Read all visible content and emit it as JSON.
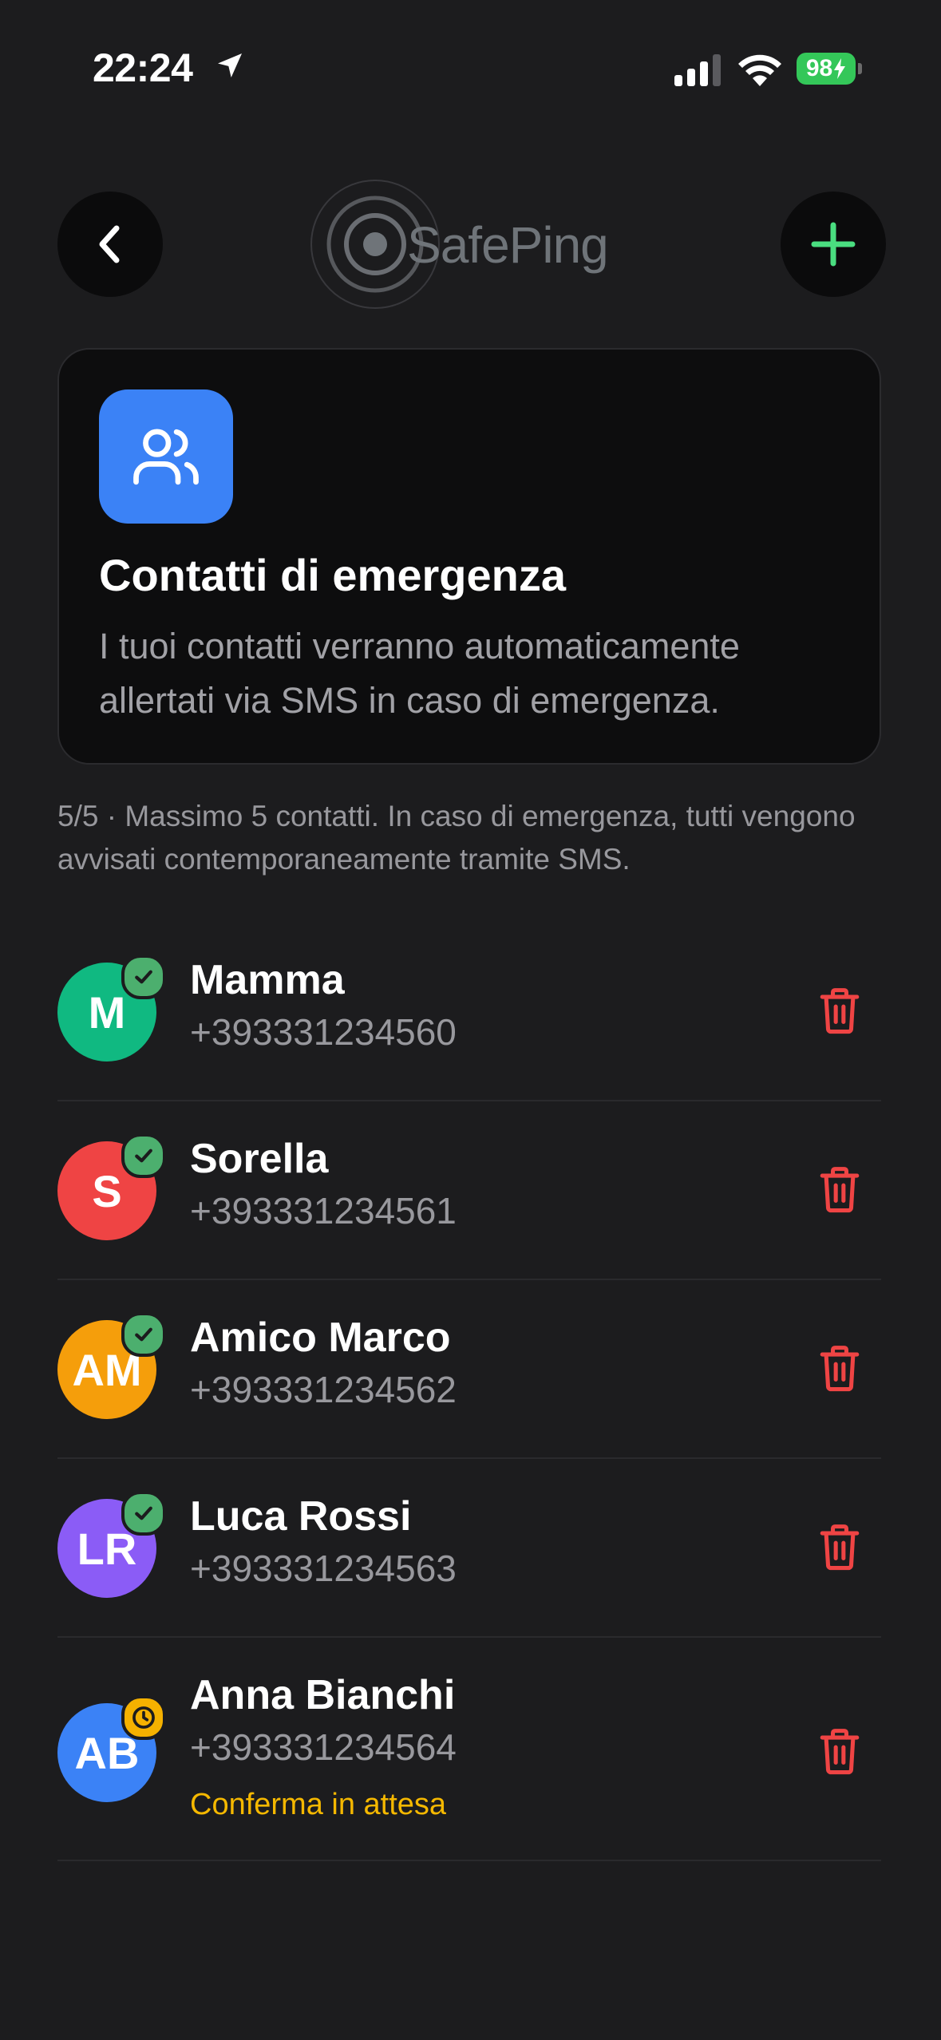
{
  "status_bar": {
    "time": "22:24",
    "battery": "98"
  },
  "header": {
    "brand_name": "SafePing",
    "back_icon": "chevron-left-icon",
    "add_icon": "plus-icon"
  },
  "hero": {
    "icon": "users-icon",
    "title": "Contatti di emergenza",
    "description": "I tuoi contatti verranno automaticamente allertati via SMS in caso di emergenza."
  },
  "note": "5/5 · Massimo 5 contatti. In caso di emergenza, tutti vengono avvisati contemporaneamente tramite SMS.",
  "contacts": [
    {
      "initials": "M",
      "name": "Mamma",
      "phone": "+393331234560",
      "color": "#10b981",
      "status": "confirmed",
      "status_label": ""
    },
    {
      "initials": "S",
      "name": "Sorella",
      "phone": "+393331234561",
      "color": "#ef4444",
      "status": "confirmed",
      "status_label": ""
    },
    {
      "initials": "AM",
      "name": "Amico Marco",
      "phone": "+393331234562",
      "color": "#f59e0b",
      "status": "confirmed",
      "status_label": ""
    },
    {
      "initials": "LR",
      "name": "Luca Rossi",
      "phone": "+393331234563",
      "color": "#8b5cf6",
      "status": "confirmed",
      "status_label": ""
    },
    {
      "initials": "AB",
      "name": "Anna Bianchi",
      "phone": "+393331234564",
      "color": "#3b82f6",
      "status": "pending",
      "status_label": "Conferma in attesa"
    }
  ],
  "colors": {
    "background": "#1c1c1e",
    "accent_green": "#4ade80",
    "delete_red": "#ef4444",
    "pending_yellow": "#f5b800"
  }
}
